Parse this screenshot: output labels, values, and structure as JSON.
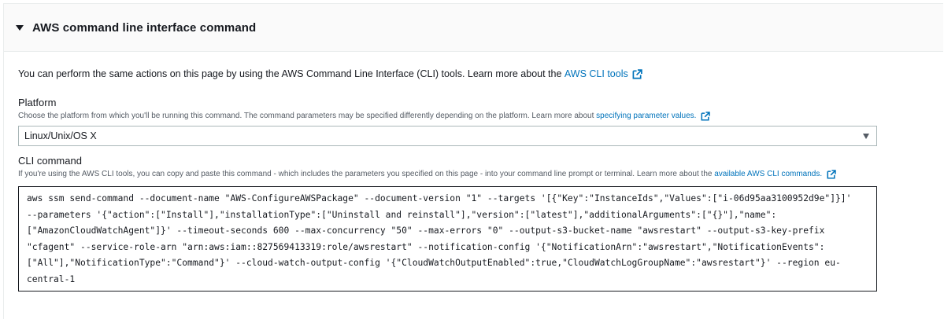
{
  "section": {
    "title": "AWS command line interface command"
  },
  "intro": {
    "text": "You can perform the same actions on this page by using the AWS Command Line Interface (CLI) tools. Learn more about the",
    "link_label": "AWS CLI tools"
  },
  "platform": {
    "label": "Platform",
    "description": "Choose the platform from which you'll be running this command. The command parameters may be specified differently depending on the platform. Learn more about",
    "link_label": "specifying parameter values.",
    "selected": "Linux/Unix/OS X"
  },
  "cli": {
    "label": "CLI command",
    "description": "If you're using the AWS CLI tools, you can copy and paste this command - which includes the parameters you specified on this page - into your command line prompt or terminal. Learn more about the",
    "link_label": "available AWS CLI commands.",
    "lines": [
      "aws ssm send-command --document-name \"AWS-ConfigureAWSPackage\" --document-version \"1\" --targets '[{\"Key\":\"InstanceIds\",\"Values\":[\"i-06d95aa3100952d9e\"]}]'",
      "--parameters '{\"action\":[\"Install\"],\"installationType\":[\"Uninstall and reinstall\"],\"version\":[\"latest\"],\"additionalArguments\":[\"{}\"],\"name\":",
      "[\"AmazonCloudWatchAgent\"]}' --timeout-seconds 600 --max-concurrency \"50\" --max-errors \"0\" --output-s3-bucket-name \"awsrestart\" --output-s3-key-prefix",
      "\"cfagent\" --service-role-arn \"arn:aws:iam::827569413319:role/awsrestart\" --notification-config '{\"NotificationArn\":\"awsrestart\",\"NotificationEvents\":",
      "[\"All\"],\"NotificationType\":\"Command\"}' --cloud-watch-output-config '{\"CloudWatchOutputEnabled\":true,\"CloudWatchLogGroupName\":\"awsrestart\"}' --region eu-",
      "central-1"
    ]
  },
  "colors": {
    "link": "#0073bb",
    "text": "#16191f",
    "muted": "#545b64",
    "header_bg": "#fafafa"
  }
}
